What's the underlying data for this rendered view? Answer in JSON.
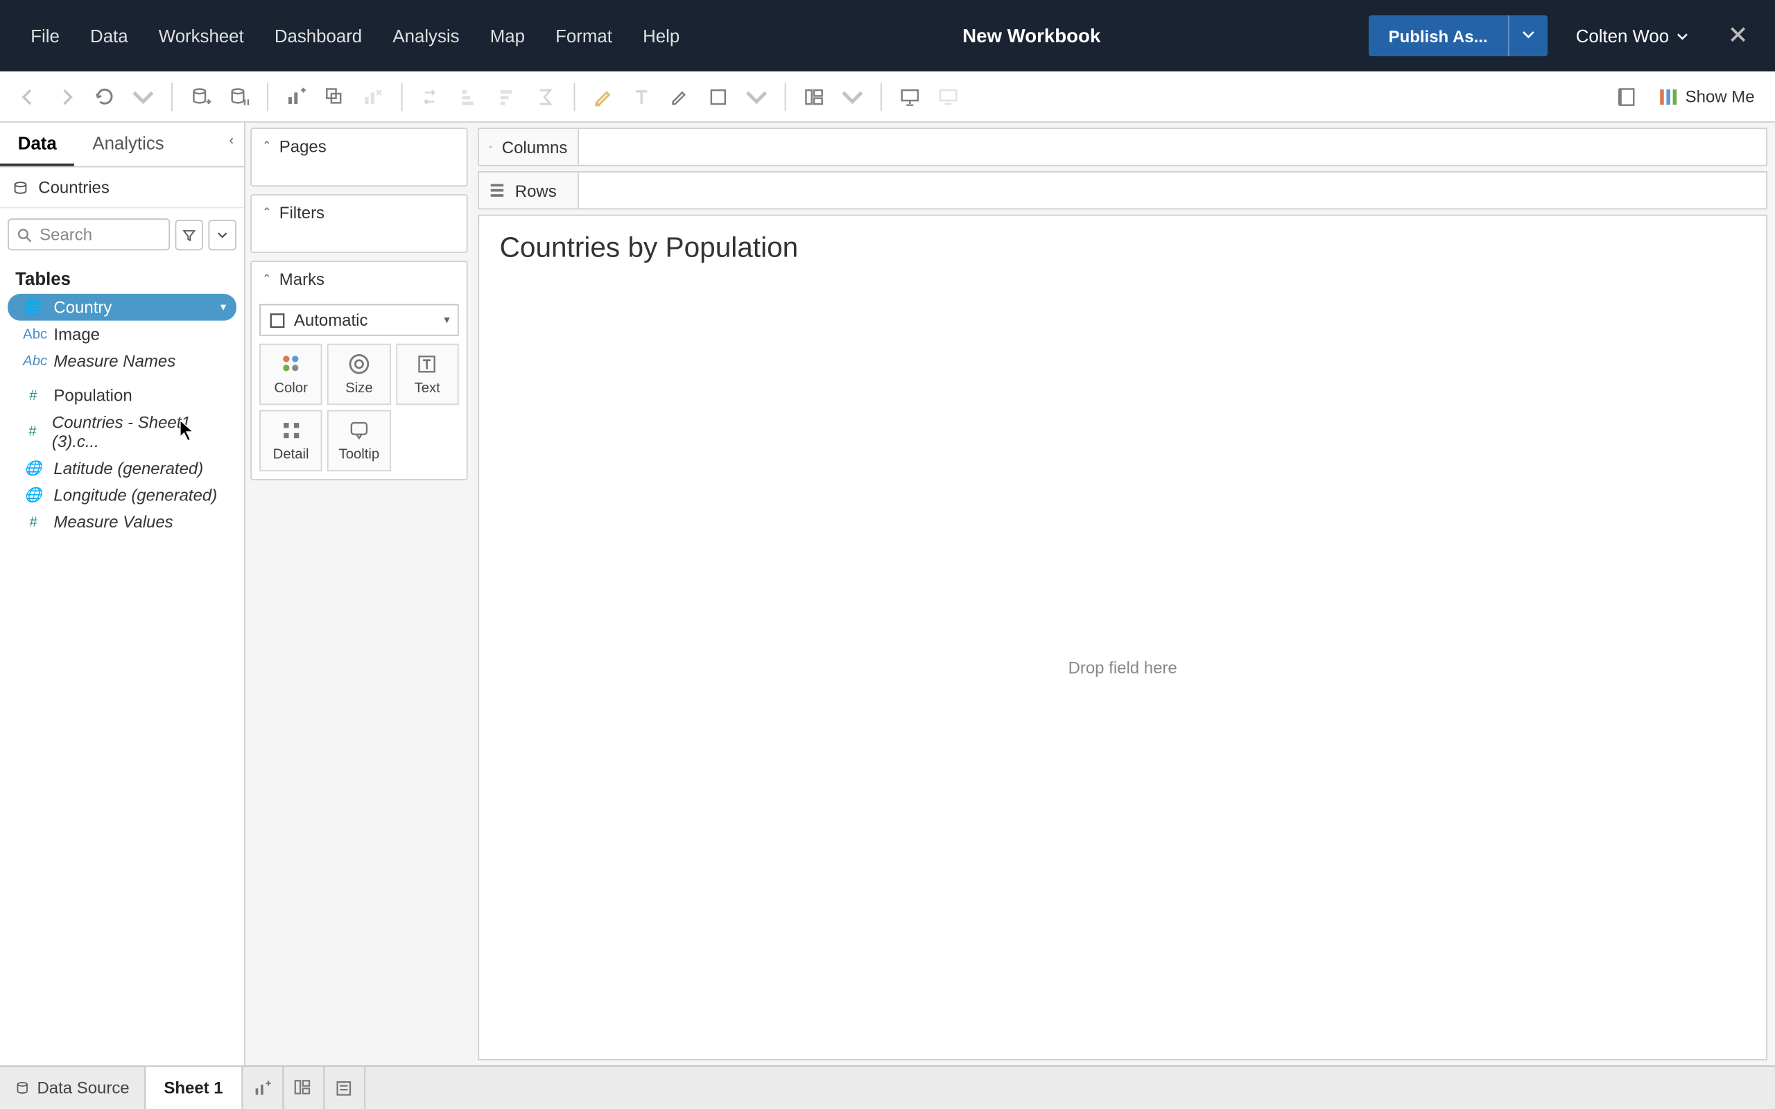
{
  "header": {
    "menus": [
      "File",
      "Data",
      "Worksheet",
      "Dashboard",
      "Analysis",
      "Map",
      "Format",
      "Help"
    ],
    "title": "New Workbook",
    "publish_label": "Publish As...",
    "user_name": "Colten Woo"
  },
  "toolbar": {
    "showme_label": "Show Me"
  },
  "sidebar": {
    "tabs": {
      "data": "Data",
      "analytics": "Analytics"
    },
    "datasource": "Countries",
    "search_placeholder": "Search",
    "tables_label": "Tables",
    "fields": [
      {
        "name": "Country",
        "icon": "globe",
        "color": "blue",
        "selected": true,
        "italic": false
      },
      {
        "name": "Image",
        "icon": "abc",
        "color": "blue",
        "selected": false,
        "italic": false
      },
      {
        "name": "Measure Names",
        "icon": "abc",
        "color": "blue",
        "selected": false,
        "italic": true
      },
      {
        "name": "Population",
        "icon": "hash",
        "color": "teal",
        "selected": false,
        "italic": false
      },
      {
        "name": "Countries - Sheet1 (3).c...",
        "icon": "hash",
        "color": "teal",
        "selected": false,
        "italic": true
      },
      {
        "name": "Latitude (generated)",
        "icon": "globe",
        "color": "teal",
        "selected": false,
        "italic": true
      },
      {
        "name": "Longitude (generated)",
        "icon": "globe",
        "color": "teal",
        "selected": false,
        "italic": true
      },
      {
        "name": "Measure Values",
        "icon": "hash",
        "color": "teal",
        "selected": false,
        "italic": true
      }
    ]
  },
  "cards": {
    "pages": "Pages",
    "filters": "Filters",
    "marks": "Marks",
    "mark_type": "Automatic",
    "mark_buttons": [
      "Color",
      "Size",
      "Text",
      "Detail",
      "Tooltip"
    ]
  },
  "shelves": {
    "columns": "Columns",
    "rows": "Rows"
  },
  "canvas": {
    "title": "Countries by Population",
    "drop_hint": "Drop field here"
  },
  "bottom": {
    "data_source": "Data Source",
    "sheet": "Sheet 1"
  }
}
